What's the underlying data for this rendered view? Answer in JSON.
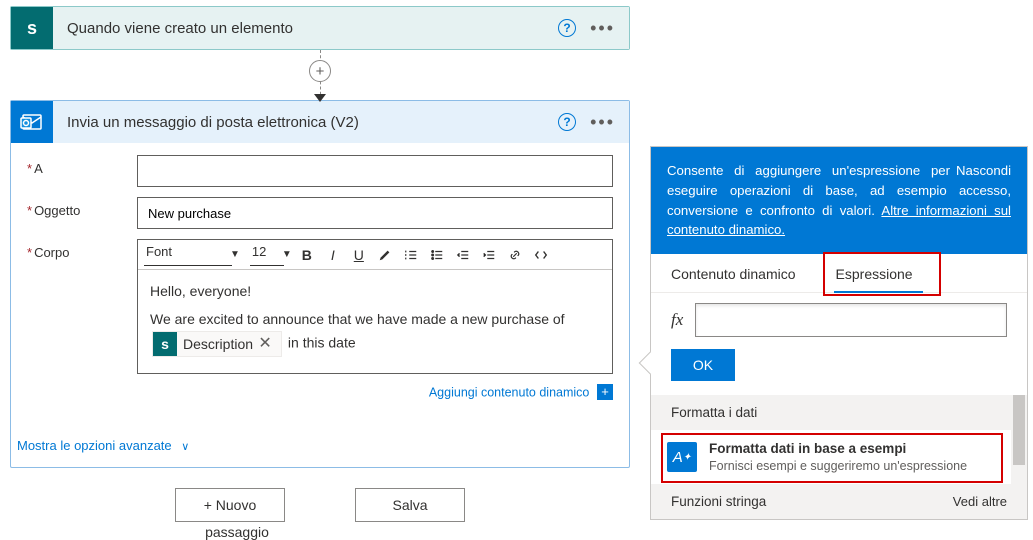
{
  "trigger": {
    "title": "Quando viene creato un elemento",
    "icon_letter": "s"
  },
  "action": {
    "title": "Invia un messaggio di posta elettronica (V2)",
    "fields": {
      "to_label": "A",
      "to_value": "",
      "subject_label": "Oggetto",
      "subject_value": "New purchase",
      "body_label": "Corpo"
    },
    "rte": {
      "font_label": "Font",
      "size_label": "12",
      "greeting": "Hello, everyone!",
      "paragraph_before": "We are excited to announce that we have made a new purchase of",
      "token_label": "Description",
      "paragraph_after": "in this date"
    },
    "add_dynamic_label": "Aggiungi contenuto dinamico",
    "advanced_label": "Mostra le opzioni avanzate"
  },
  "footer": {
    "new_step_label": "+ Nuovo",
    "new_step_suffix": "passaggio",
    "save_label": "Salva"
  },
  "panel": {
    "blurb_1": "Consente di aggiungere un'espressione per eseguire operazioni di base, ad esempio accesso, conversione e confronto di valori. ",
    "more_info": "Altre informazioni sul contenuto dinamico.",
    "hide_label": "Nascondi",
    "tabs": {
      "dynamic": "Contenuto dinamico",
      "expression": "Espressione"
    },
    "fx_label": "fx",
    "fx_value": "",
    "ok_label": "OK",
    "section_format": "Formatta i dati",
    "format_item": {
      "title": "Formatta dati in base a esempi",
      "subtitle": "Fornisci esempi e suggeriremo un'espressione"
    },
    "section_string": "Funzioni stringa",
    "see_more": "Vedi altre"
  }
}
